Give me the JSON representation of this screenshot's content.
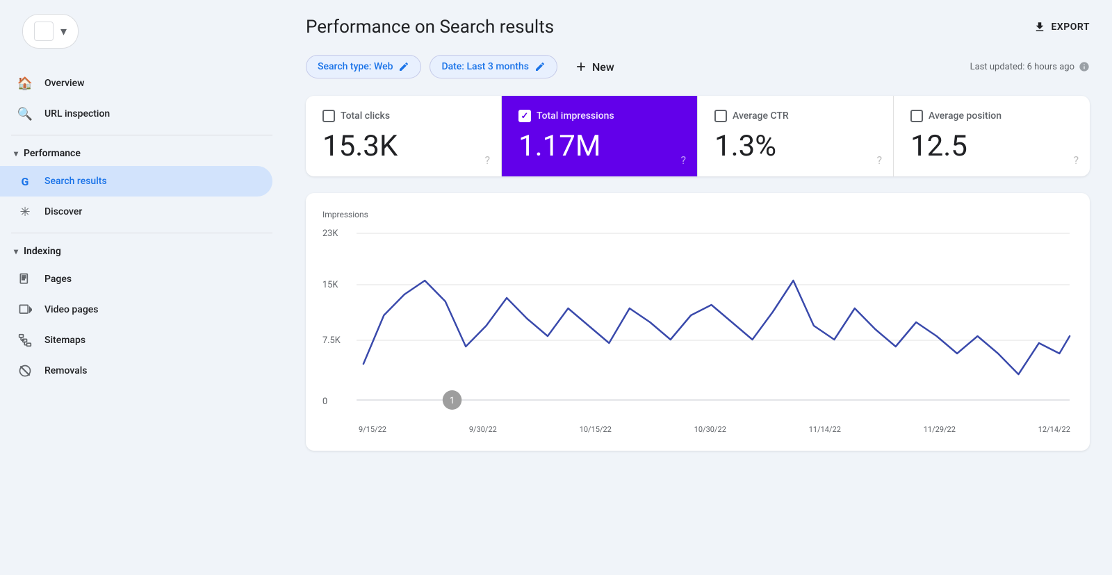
{
  "sidebar": {
    "property_placeholder": "",
    "overview_label": "Overview",
    "url_inspection_label": "URL inspection",
    "performance_label": "Performance",
    "search_results_label": "Search results",
    "discover_label": "Discover",
    "indexing_label": "Indexing",
    "pages_label": "Pages",
    "video_pages_label": "Video pages",
    "sitemaps_label": "Sitemaps",
    "removals_label": "Removals"
  },
  "header": {
    "title": "Performance on Search results",
    "export_label": "EXPORT"
  },
  "filters": {
    "search_type_label": "Search type: Web",
    "date_label": "Date: Last 3 months",
    "new_label": "New",
    "last_updated_label": "Last updated: 6 hours ago"
  },
  "metrics": [
    {
      "label": "Total clicks",
      "value": "15.3K",
      "active": false,
      "checked": false
    },
    {
      "label": "Total impressions",
      "value": "1.17M",
      "active": true,
      "checked": true
    },
    {
      "label": "Average CTR",
      "value": "1.3%",
      "active": false,
      "checked": false
    },
    {
      "label": "Average position",
      "value": "12.5",
      "active": false,
      "checked": false
    }
  ],
  "chart": {
    "y_label": "Impressions",
    "y_ticks": [
      "23K",
      "15K",
      "7.5K",
      "0"
    ],
    "x_labels": [
      "9/15/22",
      "9/30/22",
      "10/15/22",
      "10/30/22",
      "11/14/22",
      "11/29/22",
      "12/14/22"
    ],
    "accent_color": "#3949ab",
    "annotation_label": "1"
  }
}
